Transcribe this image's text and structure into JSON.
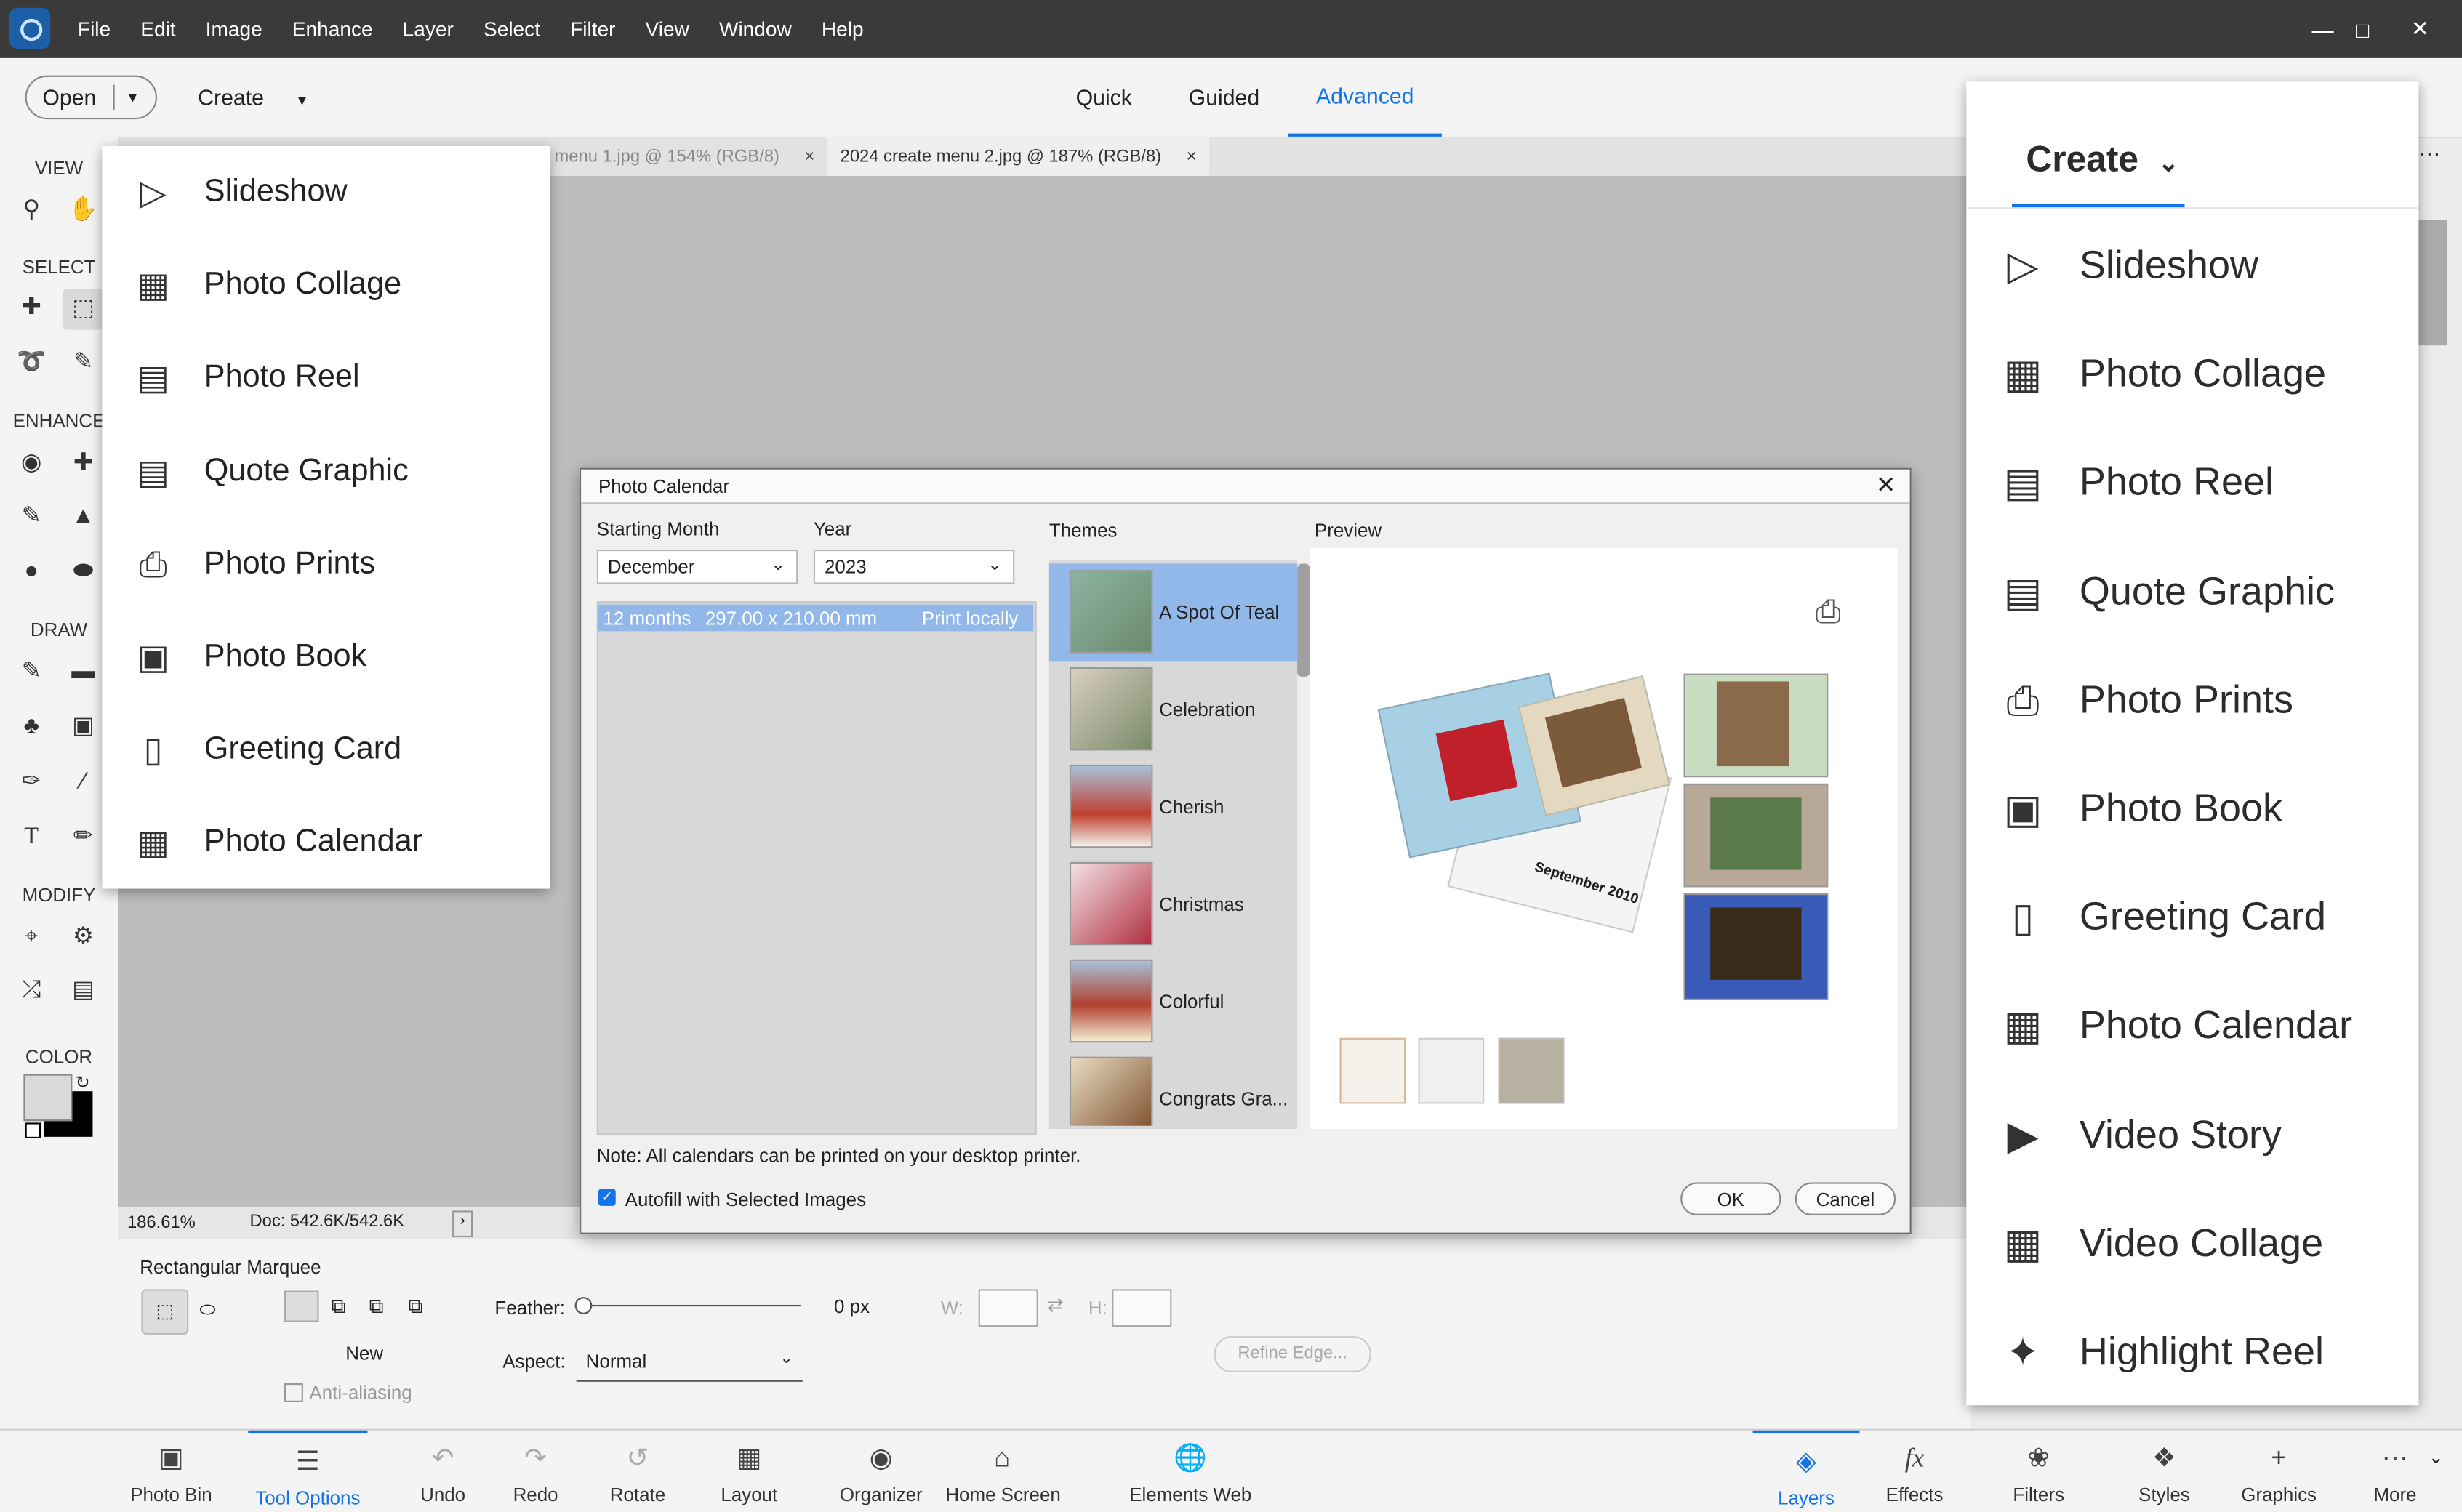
{
  "menubar": {
    "items": [
      "File",
      "Edit",
      "Image",
      "Enhance",
      "Layer",
      "Select",
      "Filter",
      "View",
      "Window",
      "Help"
    ]
  },
  "topbar": {
    "open_label": "Open",
    "create_label": "Create",
    "modes": [
      "Quick",
      "Guided",
      "Advanced"
    ],
    "active_mode": "Advanced"
  },
  "toolbar": {
    "sections": [
      "VIEW",
      "SELECT",
      "ENHANCE",
      "DRAW",
      "MODIFY",
      "COLOR"
    ]
  },
  "doc_tabs": [
    {
      "label": "menu 1.jpg @ 154% (RGB/8)"
    },
    {
      "label": "2024 create menu 2.jpg @ 187% (RGB/8)"
    }
  ],
  "statusbar": {
    "zoom": "186.61%",
    "doc": "Doc: 542.6K/542.6K"
  },
  "tool_options": {
    "tool_name": "Rectangular Marquee",
    "new_label": "New",
    "anti_alias_label": "Anti-aliasing",
    "feather_label": "Feather:",
    "feather_value": "0 px",
    "w_label": "W:",
    "h_label": "H:",
    "aspect_label": "Aspect:",
    "aspect_value": "Normal",
    "refine_label": "Refine Edge..."
  },
  "left_menu": {
    "items": [
      "Slideshow",
      "Photo Collage",
      "Photo Reel",
      "Quote Graphic",
      "Photo Prints",
      "Photo Book",
      "Greeting Card",
      "Photo Calendar"
    ]
  },
  "dialog": {
    "title": "Photo Calendar",
    "starting_month_label": "Starting Month",
    "starting_month_value": "December",
    "year_label": "Year",
    "year_value": "2023",
    "option_row": {
      "months": "12 months",
      "size": "297.00 x 210.00 mm",
      "print": "Print locally"
    },
    "themes_label": "Themes",
    "themes": [
      "A Spot Of Teal",
      "Celebration",
      "Cherish",
      "Christmas",
      "Colorful",
      "Congrats Gra..."
    ],
    "selected_theme": "A Spot Of Teal",
    "preview_label": "Preview",
    "preview_calendar_text": "September 2010",
    "note": "Note: All calendars can be printed on your desktop printer.",
    "autofill_label": "Autofill with Selected Images",
    "autofill_checked": true,
    "ok_label": "OK",
    "cancel_label": "Cancel"
  },
  "right_panel": {
    "title": "Create",
    "items": [
      "Slideshow",
      "Photo Collage",
      "Photo Reel",
      "Quote Graphic",
      "Photo Prints",
      "Photo Book",
      "Greeting Card",
      "Photo Calendar",
      "Video Story",
      "Video Collage",
      "Highlight Reel"
    ]
  },
  "bottombar": {
    "left": [
      "Photo Bin",
      "Tool Options",
      "Undo",
      "Redo",
      "Rotate",
      "Layout",
      "Organizer",
      "Home Screen",
      "Elements Web"
    ],
    "right": [
      "Layers",
      "Effects",
      "Filters",
      "Styles",
      "Graphics",
      "More"
    ],
    "active_left": "Tool Options",
    "active_right": "Layers"
  },
  "colors": {
    "accent": "#1473e6",
    "menubar": "#3a3a3a",
    "theme_selected": "#91b8e9"
  }
}
